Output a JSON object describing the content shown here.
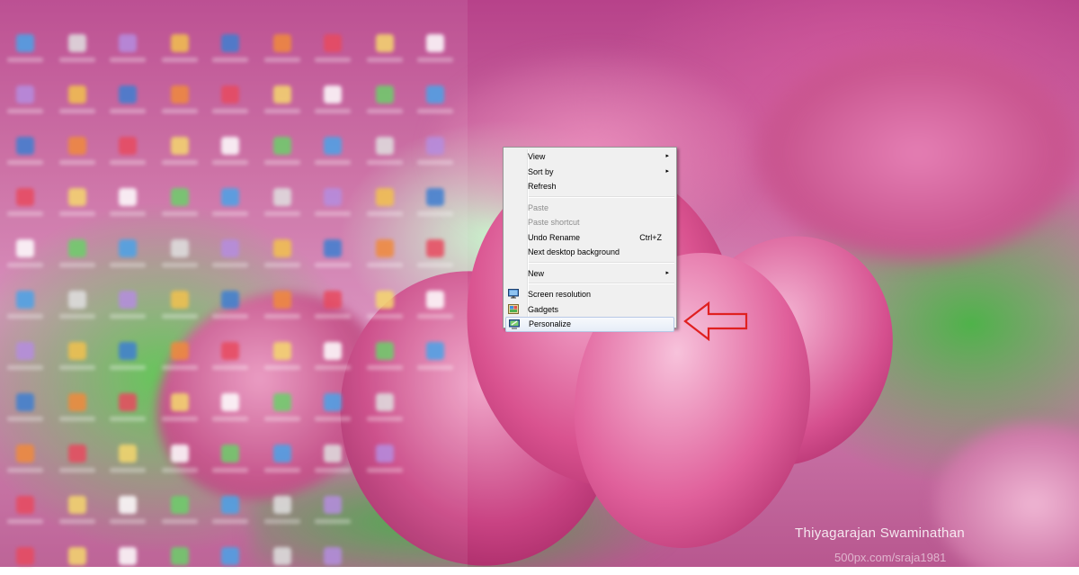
{
  "context_menu": {
    "items": [
      {
        "label": "View",
        "submenu": true
      },
      {
        "label": "Sort by",
        "submenu": true
      },
      {
        "label": "Refresh"
      },
      {
        "label": "Paste",
        "disabled": true
      },
      {
        "label": "Paste shortcut",
        "disabled": true
      },
      {
        "label": "Undo Rename",
        "shortcut": "Ctrl+Z"
      },
      {
        "label": "Next desktop background"
      },
      {
        "label": "New",
        "submenu": true
      },
      {
        "label": "Screen resolution",
        "icon": "monitor-icon"
      },
      {
        "label": "Gadgets",
        "icon": "gadgets-icon"
      },
      {
        "label": "Personalize",
        "icon": "personalize-icon",
        "highlighted": true
      }
    ],
    "submenu_arrow": "▸"
  },
  "annotation": {
    "arrow_color": "#e02020",
    "points_to": "Personalize"
  },
  "watermark": {
    "name": "Thiyagarajan Swaminathan",
    "url": "500px.com/sraja1981"
  },
  "colors": {
    "menu_bg": "#f0f0f0",
    "menu_border": "#979797",
    "highlight_border": "#b7c9e6",
    "disabled_text": "#8d8d8d"
  }
}
